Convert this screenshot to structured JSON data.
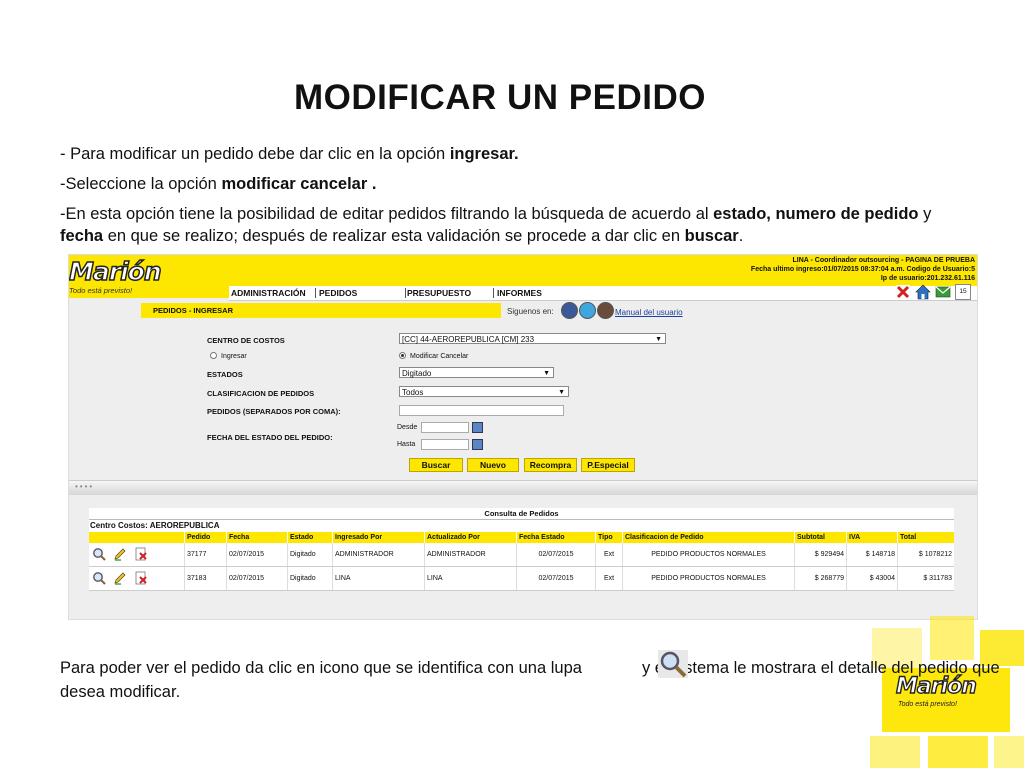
{
  "slide": {
    "title": "MODIFICAR UN PEDIDO",
    "line1_pre": "- Para modificar  un pedido debe dar clic en la opción ",
    "line1_bold": "ingresar.",
    "line2_pre": "-Seleccione la opción ",
    "line2_bold": "modificar cancelar .",
    "line3_a": "-En esta opción tiene la posibilidad de editar pedidos filtrando la búsqueda de acuerdo al ",
    "line3_b": "estado, numero de pedido",
    "line3_c": " y ",
    "line3_d": "fecha",
    "line3_e": " en que se realizo; después de realizar esta validación se procede a dar clic en ",
    "line3_f": "buscar",
    "line3_g": ".",
    "footer_a": "Para poder ver el pedido da clic en icono que se identifica con una lupa",
    "footer_b": "y el sistema le mostrara el detalle del pedido que desea modificar.",
    "brand_color": "#fde600"
  },
  "app": {
    "logo_name": "Marión",
    "logo_tagline": "Todo está previsto!",
    "user_line1": "LINA - Coordinador outsourcing - PAGINA DE PRUEBA",
    "user_line2": "Fecha ultimo ingreso:01/07/2015 08:37:04 a.m.   Codigo de Usuario:5",
    "user_line3": "Ip de usuario:201.232.61.116",
    "nav": [
      "ADMINISTRACIÓN",
      "PEDIDOS",
      "PRESUPUESTO",
      "INFORMES"
    ],
    "subtab": "PEDIDOS - INGRESAR",
    "follow_label": "Siguenos en:",
    "manual_link": "Manual del usuario",
    "calendar_day": "15"
  },
  "form": {
    "centro_label": "CENTRO DE COSTOS",
    "centro_value": "[CC] 44-AEROREPUBLICA [CM] 233",
    "radio_ingresar": "Ingresar",
    "radio_modificar": "Modificar Cancelar",
    "estados_label": "ESTADOS",
    "estados_value": "Digitado",
    "clasif_label": "CLASIFICACION DE PEDIDOS",
    "clasif_value": "Todos",
    "pedidos_label": "PEDIDOS (SEPARADOS POR COMA):",
    "pedidos_value": "",
    "fecha_label": "FECHA DEL ESTADO DEL PEDIDO:",
    "desde_label": "Desde",
    "hasta_label": "Hasta",
    "buttons": [
      "Buscar",
      "Nuevo",
      "Recompra",
      "P.Especial"
    ]
  },
  "table": {
    "title": "Consulta de Pedidos",
    "centro": "Centro Costos: AEROREPUBLICA",
    "headers": [
      "Pedido",
      "Fecha",
      "Estado",
      "Ingresado Por",
      "Actualizado Por",
      "Fecha Estado",
      "Tipo",
      "Clasificacion de Pedido",
      "Subtotal",
      "IVA",
      "Total"
    ],
    "rows": [
      [
        "37177",
        "02/07/2015",
        "Digitado",
        "ADMINISTRADOR",
        "ADMINISTRADOR",
        "02/07/2015",
        "Ext",
        "PEDIDO PRODUCTOS NORMALES",
        "$ 929494",
        "$ 148718",
        "$ 1078212"
      ],
      [
        "37183",
        "02/07/2015",
        "Digitado",
        "LINA",
        "LINA",
        "02/07/2015",
        "Ext",
        "PEDIDO PRODUCTOS NORMALES",
        "$ 268779",
        "$ 43004",
        "$ 311783"
      ]
    ]
  }
}
